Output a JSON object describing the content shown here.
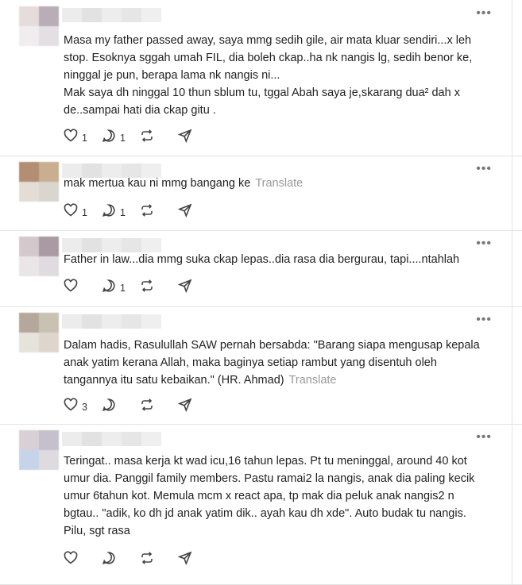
{
  "more_label": "•••",
  "posts": [
    {
      "text": "Masa my father passed away, saya mmg sedih gile, air mata kluar sendiri...x leh stop. Esoknya sggah umah FIL, dia boleh ckap..ha nk nangis lg, sedih benor ke, ninggal je pun, berapa lama nk nangis ni...\nMak saya dh ninggal 10 thun sblum tu, tggal Abah saya je,skarang dua² dah x de..sampai hati dia ckap gitu .",
      "translate": "",
      "likes": "1",
      "replies": "1",
      "reposts": "",
      "avatar_colors": [
        "#e6dcdc",
        "#b9adb8",
        "#f1ecee",
        "#e4dfe3"
      ],
      "name_colors": [
        "#ececec",
        "#e2e2e2",
        "#ededed",
        "#e6e6e6",
        "#efefef"
      ]
    },
    {
      "text": "mak mertua kau ni mmg bangang ke",
      "translate": "Translate",
      "likes": "1",
      "replies": "1",
      "reposts": "",
      "avatar_colors": [
        "#b48e74",
        "#c9ae90",
        "#e3ddd6",
        "#d9d5cf"
      ],
      "name_colors": [
        "#ececec",
        "#e2e2e2",
        "#ededed",
        "#e6e6e6",
        "#efefef"
      ]
    },
    {
      "text": "Father in law...dia mmg suka ckap lepas..dia rasa dia bergurau, tapi....ntahlah",
      "translate": "",
      "likes": "",
      "replies": "1",
      "reposts": "",
      "avatar_colors": [
        "#d4c8cc",
        "#a99aa3",
        "#eae6e8",
        "#e0dbde"
      ],
      "name_colors": [
        "#ececec",
        "#e2e2e2",
        "#ededed",
        "#e6e6e6",
        "#efefef"
      ]
    },
    {
      "text": "Dalam hadis, Rasulullah SAW pernah bersabda: \"Barang siapa mengusap kepala anak yatim kerana Allah, maka baginya setiap rambut yang disentuh oleh tangannya itu satu kebaikan.\" (HR. Ahmad)",
      "translate": "Translate",
      "likes": "3",
      "replies": "",
      "reposts": "",
      "avatar_colors": [
        "#b5a79a",
        "#c9c2b3",
        "#e6e2dc",
        "#dcd6cd"
      ],
      "name_colors": [
        "#ececec",
        "#e2e2e2",
        "#ededed",
        "#e6e6e6",
        "#efefef"
      ]
    },
    {
      "text": "Teringat.. masa kerja kt wad icu,16 tahun lepas. Pt tu meninggal, around 40 kot umur dia. Panggil family members. Pastu ramai2 la nangis, anak dia paling kecik umur 6tahun kot. Memula mcm x react apa, tp mak dia peluk anak nangis2 n bgtau.. \"adik, ko dh jd anak yatim dik.. ayah kau dh xde\". Auto budak tu nangis. Pilu, sgt rasa",
      "translate": "",
      "likes": "",
      "replies": "",
      "reposts": "",
      "avatar_colors": [
        "#d8d0d4",
        "#c4c0cc",
        "#c5d4e8",
        "#dedbe0"
      ],
      "name_colors": [
        "#ececec",
        "#e2e2e2",
        "#ededed",
        "#e6e6e6",
        "#efefef"
      ]
    }
  ]
}
